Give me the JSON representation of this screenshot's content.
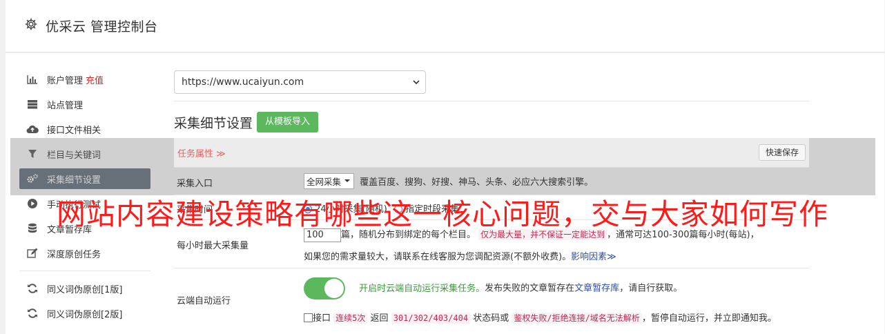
{
  "header": {
    "title": "优采云 管理控制台"
  },
  "sidebar": {
    "items": [
      {
        "label": "账户管理",
        "extra": "充值",
        "icon": "bar-chart-icon"
      },
      {
        "label": "站点管理",
        "icon": "server-icon"
      },
      {
        "label": "接口文件相关",
        "icon": "cloud-upload-icon"
      },
      {
        "label": "栏目与关键词",
        "icon": "filter-icon"
      },
      {
        "label": "采集细节设置",
        "icon": "gears-icon",
        "active": true
      },
      {
        "label": "手动执行测试",
        "icon": "play-circle-icon"
      },
      {
        "label": "文章暂存库",
        "icon": "database-icon"
      },
      {
        "label": "深度原创任务",
        "icon": "edit-icon"
      }
    ],
    "items2": [
      {
        "label": "同义词伪原创[1版]",
        "icon": "refresh-icon"
      },
      {
        "label": "同义词伪原创[2版]",
        "icon": "refresh-icon"
      }
    ]
  },
  "content": {
    "url_select": "https://www.ucaiyun.com",
    "section_title": "采集细节设置",
    "import_button": "从模板导入",
    "table": {
      "task_attr": "任务属性 ≫",
      "quick_save": "快速保存",
      "rows": {
        "entry": {
          "label": "采集入口",
          "select": "全网采集",
          "desc": "覆盖百度、搜狗、好搜、神马、头条、必应六大搜索引擎。"
        },
        "time": {
          "label": "采集时间",
          "opt1": "24小时采集(随机)",
          "opt2": "指定时段采集"
        },
        "max": {
          "label": "每小时最大采集量",
          "value": "100",
          "desc1": "篇，随机分布到绑定的每个栏目。",
          "code": "仅为最大量，并不保证一定能达到",
          "desc2": "，通常可达100-300篇每小时(每站)，",
          "desc3": "如果您的需求量较大，请联系在线客服为您调配资源(不额外收费)。",
          "link": "影响因素≫"
        },
        "cloud": {
          "label": "云端自动运行",
          "green": "开启时云端自动运行采集任务。",
          "desc_a": "发布失败的文章暂存在",
          "link": "文章暂存库",
          "desc_b": "，请自行获取。",
          "chk_a": "接口",
          "code1": "连续5次",
          "chk_b": "返回",
          "code2": "301/302/403/404",
          "chk_c": "状态码或",
          "code3": "鉴权失败/拒绝连接/域名无法解析",
          "chk_d": "，暂停自动运行，并立即通知我。"
        }
      }
    }
  },
  "watermark": "网站内容建设策略有哪些这一核心问题，交与大家如何写作"
}
